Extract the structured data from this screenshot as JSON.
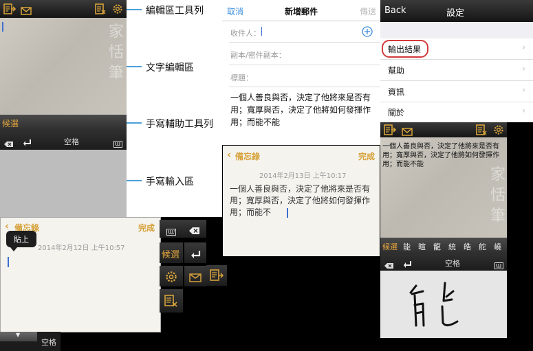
{
  "annotations": {
    "toolbar": "編輯區工具列",
    "edit_area": "文字編輯區",
    "handwriting_toolbar": "手寫輔助工具列",
    "handwriting_input": "手寫輸入區"
  },
  "panel1": {
    "watermark": "家 恬 筆",
    "candidate_label": "候選",
    "space_label": "空格"
  },
  "email": {
    "cancel": "取消",
    "title": "新增郵件",
    "send": "傳送",
    "to_label": "收件人：",
    "cc_label": "副本/密件副本：",
    "subject_label": "標題：",
    "body": "一個人善良與否，決定了他將來是否有用；寬厚與否，決定了他將如何發揮作用；而能不能"
  },
  "settings": {
    "back": "Back",
    "title": "設定",
    "items": [
      "輸出結果",
      "幫助",
      "資訊",
      "關於"
    ]
  },
  "panel_right": {
    "body": "一個人善良與否，決定了他將來是否有用；寬厚與否，決定了他將如何發揮作用；而能不能",
    "watermark": "家 恬 筆",
    "candidates": [
      "候選",
      "能",
      "暄",
      "龍",
      "統",
      "皓",
      "舵",
      "嶢"
    ],
    "space_label": "空格",
    "handwriting": "能"
  },
  "memo_left": {
    "back": "備忘錄",
    "done": "完成",
    "tooltip": "貼上",
    "date": "2014年2月12日 上午10:57",
    "space_label": "空格"
  },
  "memo_center": {
    "back": "備忘錄",
    "done": "完成",
    "date": "2014年2月13日 上午10:17",
    "body": "一個人善良與否，決定了他將來是否有用；寬厚與否，決定了他將如何發揮作用；而能不"
  },
  "side_toolbar": {
    "candidate_label": "候選"
  },
  "colors": {
    "accent_orange": "#d6a23b",
    "ios_blue": "#3b8de0",
    "annotation_blue": "#4aa0d8",
    "highlight_red": "#d23a3a"
  }
}
